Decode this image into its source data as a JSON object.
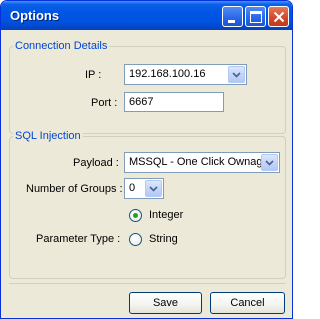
{
  "window": {
    "title": "Options"
  },
  "icons": {
    "minimize": "minimize-icon",
    "maximize": "maximize-icon",
    "close": "close-icon",
    "dropdown": "chevron-down-icon"
  },
  "colors": {
    "title_bar": "#0055e5",
    "group_legend": "#0046d5",
    "radio_selected": "#21a121"
  },
  "connection": {
    "legend": "Connection Details",
    "ip_label": "IP :",
    "ip_value": "192.168.100.16",
    "port_label": "Port :",
    "port_value": "6667"
  },
  "sql": {
    "legend": "SQL Injection",
    "payload_label": "Payload :",
    "payload_value": "MSSQL - One Click Ownag",
    "groups_label": "Number of Groups :",
    "groups_value": "0",
    "param_type_label": "Parameter Type :",
    "param_types": [
      {
        "label": "Integer",
        "selected": true
      },
      {
        "label": "String",
        "selected": false
      }
    ]
  },
  "buttons": {
    "save": "Save",
    "cancel": "Cancel"
  }
}
